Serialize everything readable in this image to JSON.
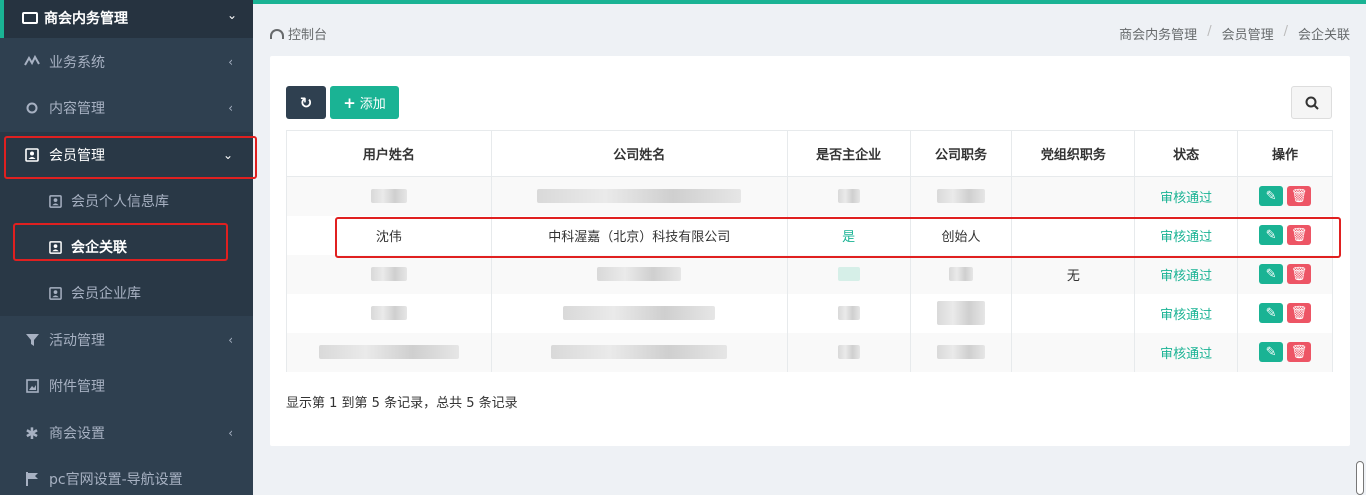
{
  "sidebar": {
    "top_label": "商会内务管理",
    "items": [
      {
        "label": "业务系统"
      },
      {
        "label": "内容管理"
      },
      {
        "label": "会员管理"
      },
      {
        "label": "活动管理"
      },
      {
        "label": "附件管理"
      },
      {
        "label": "商会设置"
      },
      {
        "label": "pc官网设置-导航设置"
      }
    ],
    "sub_items": [
      {
        "label": "会员个人信息库"
      },
      {
        "label": "会企关联"
      },
      {
        "label": "会员企业库"
      }
    ]
  },
  "breadcrumb": {
    "home": "控制台",
    "path": [
      "商会内务管理",
      "会员管理",
      "会企关联"
    ],
    "separator": "/"
  },
  "toolbar": {
    "add_label": "添加"
  },
  "table": {
    "headers": [
      "用户姓名",
      "公司姓名",
      "是否主企业",
      "公司职务",
      "党组织职务",
      "状态",
      "操作"
    ],
    "rows": [
      {
        "user": "",
        "company": "",
        "main": "",
        "position": "",
        "party": "",
        "status": "审核通过"
      },
      {
        "user": "沈伟",
        "company": "中科渥嘉（北京）科技有限公司",
        "main": "是",
        "position": "创始人",
        "party": "",
        "status": "审核通过"
      },
      {
        "user": "",
        "company": "",
        "main": "",
        "position": "",
        "party": "无",
        "status": "审核通过"
      },
      {
        "user": "",
        "company": "",
        "main": "",
        "position": "",
        "party": "",
        "status": "审核通过"
      },
      {
        "user": "",
        "company": "",
        "main": "",
        "position": "",
        "party": "",
        "status": "审核通过"
      }
    ]
  },
  "pagination_text": "显示第 1 到第 5 条记录，总共 5 条记录",
  "colors": {
    "accent": "#1ab394",
    "sidebar": "#2f4050",
    "danger": "#ed5565",
    "highlight": "#e02020"
  }
}
